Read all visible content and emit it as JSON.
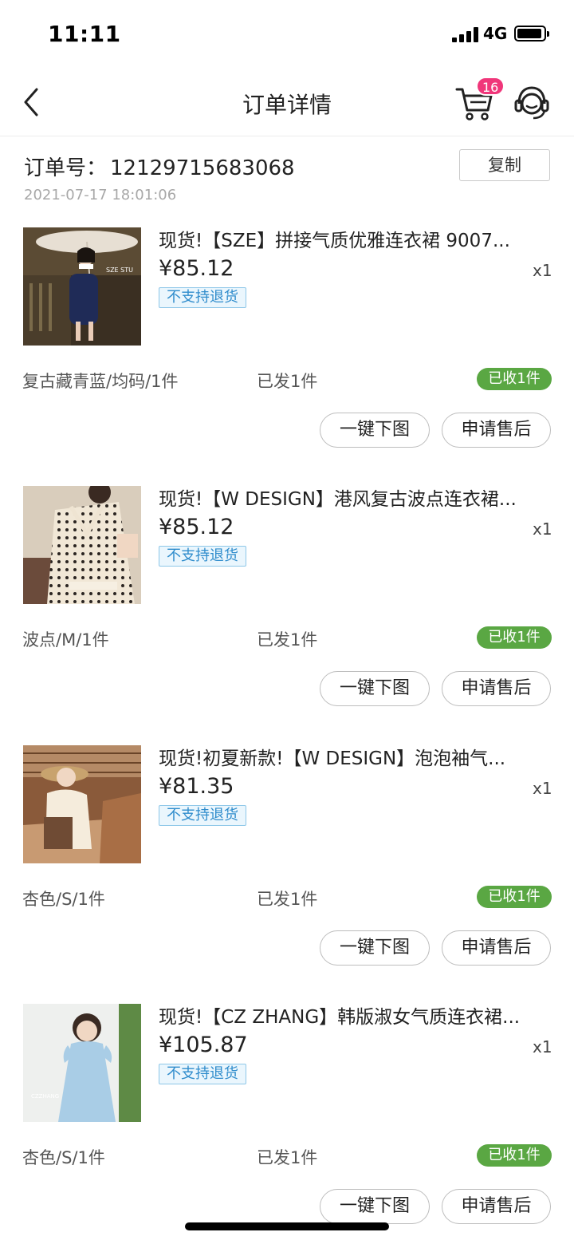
{
  "status_bar": {
    "time": "11:11",
    "network": "4G"
  },
  "nav": {
    "title": "订单详情",
    "cart_count": "16"
  },
  "order": {
    "number_label": "订单号：",
    "number": "12129715683068",
    "copy_label": "复制",
    "date": "2021-07-17 18:01:06"
  },
  "items": [
    {
      "title": "现货!【SZE】拼接气质优雅连衣裙  9007...",
      "price": "¥85.12",
      "qty": "x1",
      "return_tag": "不支持退货",
      "spec": "复古藏青蓝/均码/1件",
      "shipped": "已发1件",
      "received": "已收1件",
      "btn_download": "一键下图",
      "btn_aftersale": "申请售后"
    },
    {
      "title": "现货!【W DESIGN】港风复古波点连衣裙...",
      "price": "¥85.12",
      "qty": "x1",
      "return_tag": "不支持退货",
      "spec": "波点/M/1件",
      "shipped": "已发1件",
      "received": "已收1件",
      "btn_download": "一键下图",
      "btn_aftersale": "申请售后"
    },
    {
      "title": "现货!初夏新款!【W DESIGN】泡泡袖气...",
      "price": "¥81.35",
      "qty": "x1",
      "return_tag": "不支持退货",
      "spec": "杏色/S/1件",
      "shipped": "已发1件",
      "received": "已收1件",
      "btn_download": "一键下图",
      "btn_aftersale": "申请售后"
    },
    {
      "title": "现货!【CZ ZHANG】韩版淑女气质连衣裙...",
      "price": "¥105.87",
      "qty": "x1",
      "return_tag": "不支持退货",
      "spec": "杏色/S/1件",
      "shipped": "已发1件",
      "received": "已收1件",
      "btn_download": "一键下图",
      "btn_aftersale": "申请售后"
    }
  ],
  "colors": {
    "badge": "#f0367a",
    "received_bg": "#5aa743",
    "return_tag_border": "#8ec7e8",
    "return_tag_text": "#2f8ccc"
  }
}
